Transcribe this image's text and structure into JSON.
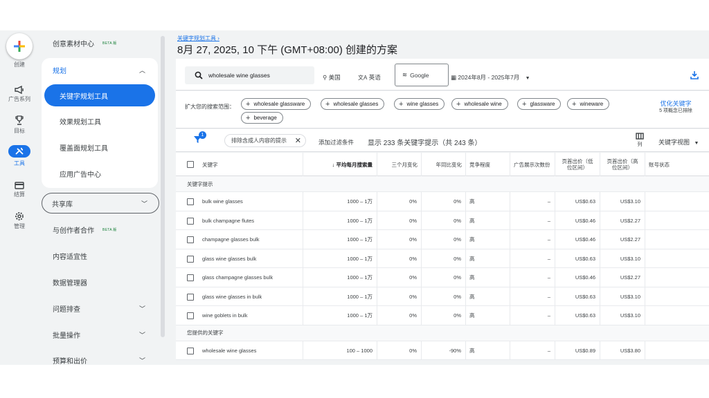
{
  "rail": {
    "create_label": "创建",
    "items": [
      {
        "label": "广告系列",
        "icon": "megaphone-icon"
      },
      {
        "label": "目标",
        "icon": "trophy-icon"
      },
      {
        "label": "工具",
        "icon": "tools-icon"
      },
      {
        "label": "结算",
        "icon": "credit-card-icon"
      },
      {
        "label": "管理",
        "icon": "gear-icon"
      }
    ]
  },
  "nav": {
    "creative": "创意素材中心",
    "beta": "BETA 版",
    "planning": "规划",
    "keyword_planner": "关键字规划工具",
    "performance_planner": "效果规划工具",
    "reach_planner": "覆盖面规划工具",
    "app_center": "应用广告中心",
    "shared_library": "共享库",
    "creators": "与创作者合作",
    "content_suitability": "内容适宜性",
    "data_manager": "数据管理器",
    "troubleshoot": "问题排查",
    "bulk": "批量操作",
    "budget": "预算和出价"
  },
  "header": {
    "breadcrumb": "关键字规划工具 ›",
    "title": "8月 27, 2025, 10 下午 (GMT+08:00) 创建的方案"
  },
  "search": {
    "keyword": "wholesale wine glasses",
    "location": "美国",
    "language": "英语",
    "network": "Google",
    "date_range": "2024年8月 - 2025年7月"
  },
  "broaden": {
    "label": "扩大您的搜索范围：",
    "chips": [
      "wholesale glassware",
      "wholesale glasses",
      "wine glasses",
      "wholesale wine",
      "glassware",
      "wineware",
      "beverage"
    ],
    "refine_link": "优化关键字",
    "refine_sub": "5 项概念已排除"
  },
  "filters": {
    "badge": "1",
    "adult_chip": "排除含成人内容的提示",
    "add_filter": "添加过滤条件",
    "shown": "显示 233 条关键字提示（共 243 条）",
    "columns_label": "列",
    "view": "关键字视图"
  },
  "table": {
    "headers": {
      "keyword": "关键字",
      "avg_searches": "↓ 平均每月搜索量",
      "three_month": "三个月变化",
      "yoy": "年同比变化",
      "competition": "竞争程度",
      "impression_share": "广告展示次数份",
      "low_bid": "页首出价（低位区间）",
      "high_bid": "页首出价（高位区间）",
      "account_status": "账号状态"
    },
    "section_ideas": "关键字提示",
    "section_provided": "您提供的关键字",
    "rows": [
      {
        "kw": "bulk wine glasses",
        "avg": "1000 – 1万",
        "m3": "0%",
        "yoy": "0%",
        "comp": "高",
        "imp": "–",
        "low": "US$0.63",
        "high": "US$3.10"
      },
      {
        "kw": "bulk champagne flutes",
        "avg": "1000 – 1万",
        "m3": "0%",
        "yoy": "0%",
        "comp": "高",
        "imp": "–",
        "low": "US$0.46",
        "high": "US$2.27"
      },
      {
        "kw": "champagne glasses bulk",
        "avg": "1000 – 1万",
        "m3": "0%",
        "yoy": "0%",
        "comp": "高",
        "imp": "–",
        "low": "US$0.46",
        "high": "US$2.27"
      },
      {
        "kw": "glass wine glasses bulk",
        "avg": "1000 – 1万",
        "m3": "0%",
        "yoy": "0%",
        "comp": "高",
        "imp": "–",
        "low": "US$0.63",
        "high": "US$3.10"
      },
      {
        "kw": "glass champagne glasses bulk",
        "avg": "1000 – 1万",
        "m3": "0%",
        "yoy": "0%",
        "comp": "高",
        "imp": "–",
        "low": "US$0.46",
        "high": "US$2.27"
      },
      {
        "kw": "glass wine glasses in bulk",
        "avg": "1000 – 1万",
        "m3": "0%",
        "yoy": "0%",
        "comp": "高",
        "imp": "–",
        "low": "US$0.63",
        "high": "US$3.10"
      },
      {
        "kw": "wine goblets in bulk",
        "avg": "1000 – 1万",
        "m3": "0%",
        "yoy": "0%",
        "comp": "高",
        "imp": "–",
        "low": "US$0.63",
        "high": "US$3.10"
      }
    ],
    "provided_rows": [
      {
        "kw": "wholesale wine glasses",
        "avg": "100 – 1000",
        "m3": "0%",
        "yoy": "-90%",
        "comp": "高",
        "imp": "–",
        "low": "US$0.89",
        "high": "US$3.80"
      }
    ]
  },
  "colors": {
    "accent": "#1a73e8",
    "background": "#f1f3f4"
  }
}
